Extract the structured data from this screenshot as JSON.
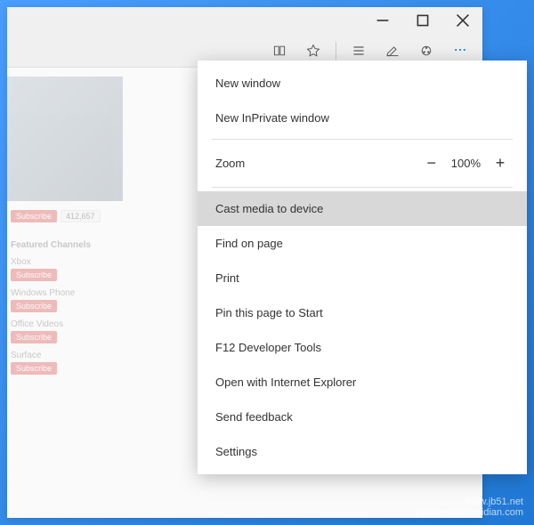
{
  "menu": {
    "new_window": "New window",
    "new_inprivate": "New InPrivate window",
    "zoom_label": "Zoom",
    "zoom_value": "100%",
    "cast": "Cast media to device",
    "find": "Find on page",
    "print": "Print",
    "pin": "Pin this page to Start",
    "devtools": "F12 Developer Tools",
    "open_ie": "Open with Internet Explorer",
    "feedback": "Send feedback",
    "settings": "Settings"
  },
  "page": {
    "subscribe_label": "Subscribe",
    "subscribe_count": "412,657",
    "section_title": "Featured Channels",
    "channels": [
      "Xbox",
      "Windows Phone",
      "Office Videos",
      "Surface"
    ]
  },
  "watermark": {
    "line1": "www.jb51.net",
    "line2": "jiaocheng.chazidian.com"
  }
}
